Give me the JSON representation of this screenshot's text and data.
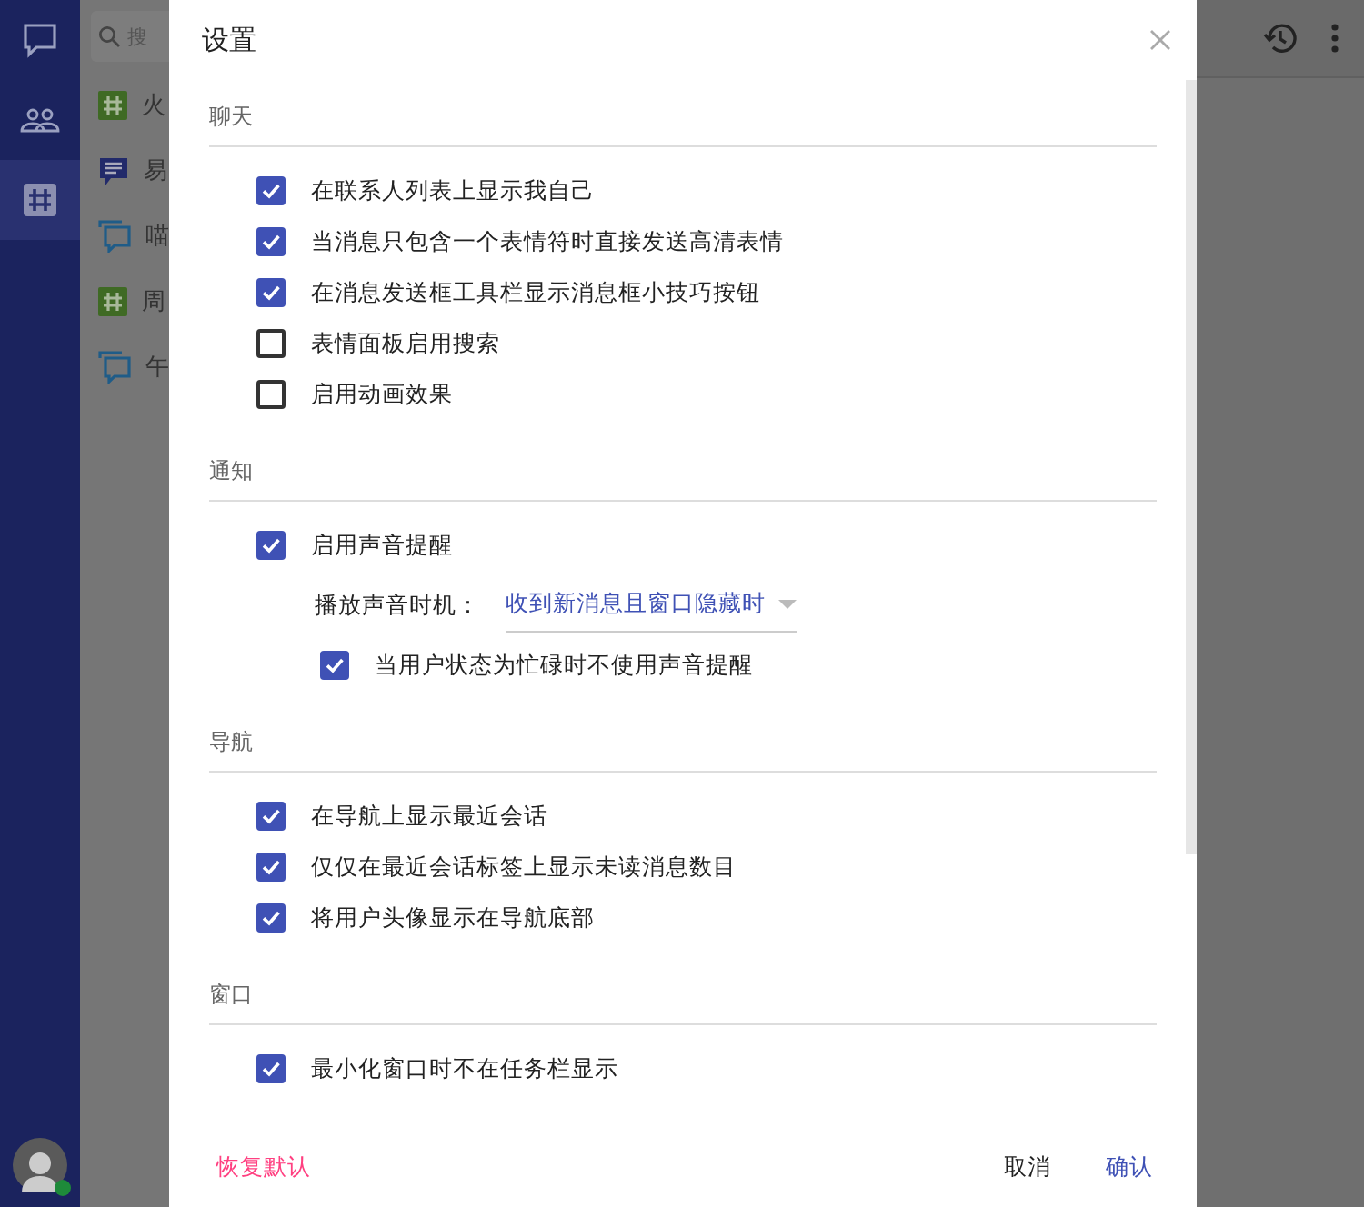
{
  "sidebar": {
    "items": [
      {
        "kind": "chat",
        "selected": false
      },
      {
        "kind": "contacts",
        "selected": false
      },
      {
        "kind": "channel",
        "selected": true
      }
    ],
    "avatar": {
      "online": true
    }
  },
  "conversation_list": {
    "search": {
      "placeholder": "搜"
    },
    "items": [
      {
        "kind": "channel",
        "name": "火"
      },
      {
        "kind": "note",
        "name": "易"
      },
      {
        "kind": "group",
        "name": "喵"
      },
      {
        "kind": "channel",
        "name": "周"
      },
      {
        "kind": "group",
        "name": "午"
      }
    ]
  },
  "dialog": {
    "title": "设置",
    "sections": [
      {
        "title": "聊天",
        "items": [
          {
            "kind": "checkbox",
            "label": "在联系人列表上显示我自己",
            "checked": true
          },
          {
            "kind": "checkbox",
            "label": "当消息只包含一个表情符时直接发送高清表情",
            "checked": true
          },
          {
            "kind": "checkbox",
            "label": "在消息发送框工具栏显示消息框小技巧按钮",
            "checked": true
          },
          {
            "kind": "checkbox",
            "label": "表情面板启用搜索",
            "checked": false
          },
          {
            "kind": "checkbox",
            "label": "启用动画效果",
            "checked": false
          }
        ]
      },
      {
        "title": "通知",
        "items": [
          {
            "kind": "checkbox",
            "label": "启用声音提醒",
            "checked": true
          },
          {
            "kind": "select",
            "label": "播放声音时机：",
            "value": "收到新消息且窗口隐藏时"
          },
          {
            "kind": "sub_checkbox",
            "label": "当用户状态为忙碌时不使用声音提醒",
            "checked": true
          }
        ]
      },
      {
        "title": "导航",
        "items": [
          {
            "kind": "checkbox",
            "label": "在导航上显示最近会话",
            "checked": true
          },
          {
            "kind": "checkbox",
            "label": "仅仅在最近会话标签上显示未读消息数目",
            "checked": true
          },
          {
            "kind": "checkbox",
            "label": "将用户头像显示在导航底部",
            "checked": true
          }
        ]
      },
      {
        "title": "窗口",
        "items": [
          {
            "kind": "checkbox",
            "label": "最小化窗口时不在任务栏显示",
            "checked": true
          }
        ]
      }
    ],
    "buttons": {
      "reset": "恢复默认",
      "cancel": "取消",
      "confirm": "确认"
    }
  }
}
